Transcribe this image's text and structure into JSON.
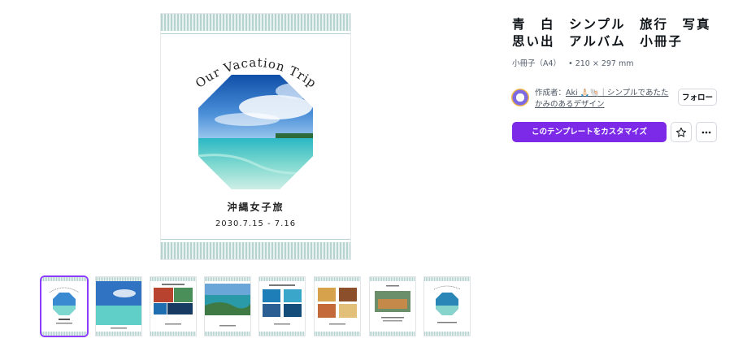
{
  "preview": {
    "arc_title": "Our Vacation Trip",
    "subtitle": "沖縄女子旅",
    "date": "2030.7.15 - 7.16"
  },
  "panel": {
    "title": "青　白　シンプル　旅行　写真　思い出　アルバム　小冊子",
    "category": "小冊子（A4）",
    "size": "• 210 × 297 mm",
    "creator_prefix": "作成者：",
    "creator_name": "Aki 🙏🏻🐚｜シンプルであたたかみのあるデザイン",
    "follow_label": "フォロー",
    "customize_label": "このテンプレートをカスタマイズ",
    "star_icon": "star-icon",
    "more_icon": "more-icon"
  },
  "colors": {
    "accent": "#7d2ae8",
    "stripe": "#b6d3cf",
    "selected_outline": "#8b3dff"
  }
}
